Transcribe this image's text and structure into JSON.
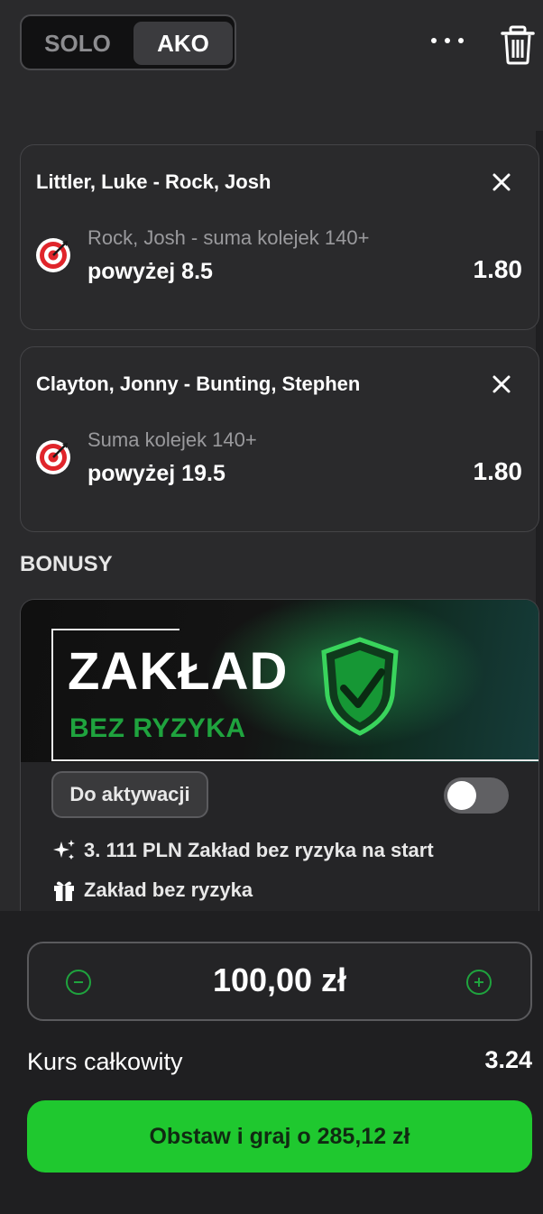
{
  "mode_toggle": {
    "solo": "SOLO",
    "ako": "AKO",
    "active": "AKO"
  },
  "icons": {
    "more": "more-dots-icon",
    "trash": "trash-icon",
    "close": "close-icon",
    "sport": "darts-target-icon",
    "sparkle": "sparkle-icon",
    "gift": "gift-icon",
    "minus": "minus-circle-icon",
    "plus": "plus-circle-icon"
  },
  "bets": [
    {
      "event": "Littler, Luke - Rock, Josh",
      "market": "Rock, Josh - suma kolejek 140+",
      "selection": "powyżej 8.5",
      "odds": "1.80"
    },
    {
      "event": "Clayton, Jonny - Bunting, Stephen",
      "market": "Suma kolejek 140+",
      "selection": "powyżej 19.5",
      "odds": "1.80"
    }
  ],
  "bonuses": {
    "title": "BONUSY",
    "banner_title": "ZAKŁAD",
    "banner_subtitle": "BEZ RYZYKA",
    "activate_label": "Do aktywacji",
    "toggle_on": false,
    "perks": [
      "3. 111 PLN Zakład bez ryzyka na start",
      "Zakład bez ryzyka"
    ]
  },
  "footer": {
    "stake": "100,00 zł",
    "total_label": "Kurs całkowity",
    "total_odds": "3.24",
    "place_button": "Obstaw i graj o 285,12 zł"
  },
  "colors": {
    "accent": "#1fc82f",
    "bonus_green": "#1fa33e",
    "background": "#2a2a2c"
  }
}
